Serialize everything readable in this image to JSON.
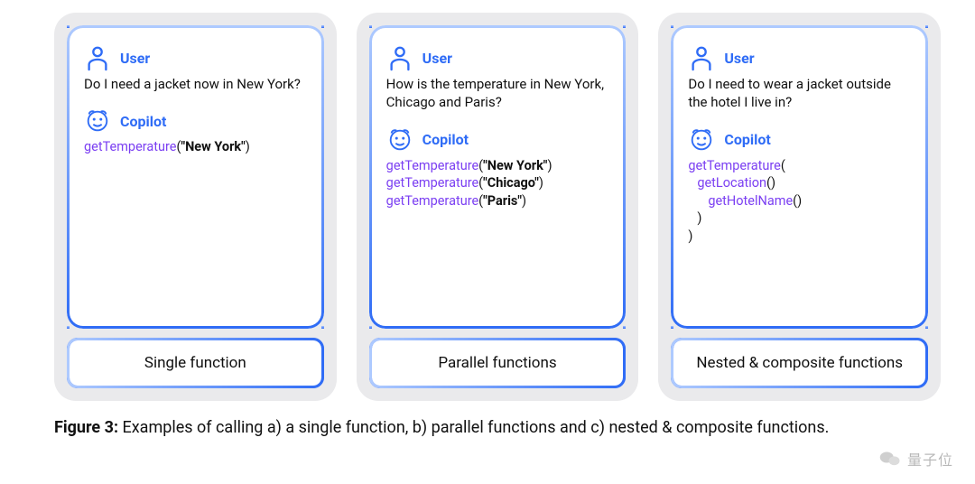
{
  "labels": {
    "user": "User",
    "copilot": "Copilot"
  },
  "cards": [
    {
      "user_text": "Do I need a jacket now in New York?",
      "code": [
        [
          {
            "t": "getTemperature",
            "c": "fn"
          },
          {
            "t": "(",
            "c": ""
          },
          {
            "t": "\"New York\"",
            "c": "str"
          },
          {
            "t": ")",
            "c": ""
          }
        ]
      ],
      "label": "Single function"
    },
    {
      "user_text": "How is the temperature in New York, Chicago and Paris?",
      "code": [
        [
          {
            "t": "getTemperature",
            "c": "fn"
          },
          {
            "t": "(",
            "c": ""
          },
          {
            "t": "\"New York\"",
            "c": "str"
          },
          {
            "t": ")",
            "c": ""
          }
        ],
        [
          {
            "t": "getTemperature",
            "c": "fn"
          },
          {
            "t": "(",
            "c": ""
          },
          {
            "t": "\"Chicago\"",
            "c": "str"
          },
          {
            "t": ")",
            "c": ""
          }
        ],
        [
          {
            "t": "getTemperature",
            "c": "fn"
          },
          {
            "t": "(",
            "c": ""
          },
          {
            "t": "\"Paris\"",
            "c": "str"
          },
          {
            "t": ")",
            "c": ""
          }
        ]
      ],
      "label": "Parallel functions"
    },
    {
      "user_text": "Do I need to wear a jacket outside the hotel I live in?",
      "code": [
        [
          {
            "t": "getTemperature",
            "c": "fn"
          },
          {
            "t": "(",
            "c": ""
          }
        ],
        [
          {
            "t": "getLocation",
            "c": "fn pad1"
          },
          {
            "t": "()",
            "c": ""
          }
        ],
        [
          {
            "t": "getHotelName",
            "c": "fn pad2"
          },
          {
            "t": "()",
            "c": ""
          }
        ],
        [
          {
            "t": " )",
            "c": "pad1"
          }
        ],
        [
          {
            "t": ")",
            "c": ""
          }
        ]
      ],
      "label": "Nested & composite functions"
    }
  ],
  "caption_bold": "Figure 3:",
  "caption_rest": " Examples of calling a) a single function, b) parallel functions and c) nested & composite functions.",
  "watermark": "量子位"
}
